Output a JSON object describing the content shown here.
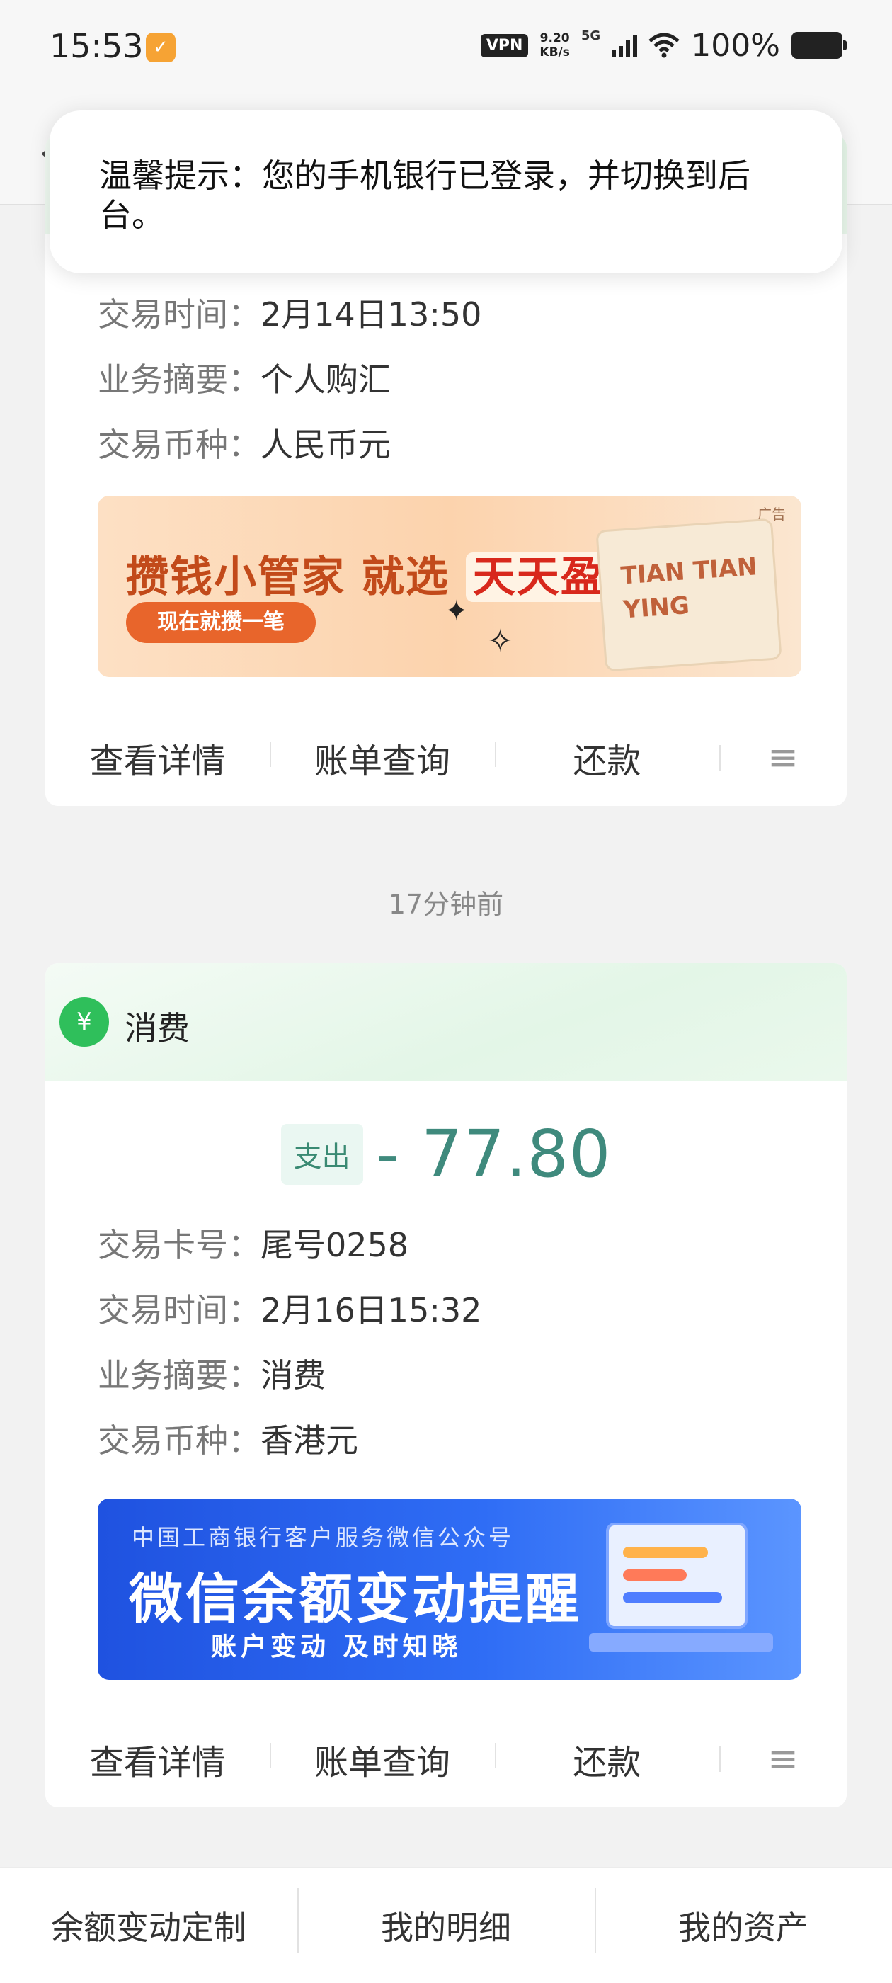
{
  "status_bar": {
    "time": "15:53",
    "app_badge": "✓",
    "vpn": "VPN",
    "speed_value": "9.20",
    "speed_unit": "KB/s",
    "network": "5G",
    "battery": "100%"
  },
  "toast": {
    "text": "温馨提示：您的手机银行已登录，并切换到后台。"
  },
  "card1": {
    "rows": [
      {
        "key": "交易时间：",
        "value": "2月14日13:50"
      },
      {
        "key": "业务摘要：",
        "value": "个人购汇"
      },
      {
        "key": "交易币种：",
        "value": "人民币元"
      }
    ],
    "banner": {
      "title_main": "攒钱小管家 就选",
      "title_highlight": "天天盈",
      "button": "现在就攒一笔",
      "ad_label": "广告",
      "board_text": "TIAN TIAN YING"
    },
    "actions": [
      "查看详情",
      "账单查询",
      "还款",
      "≡"
    ]
  },
  "timestamp": "17分钟前",
  "card2": {
    "title": "消费",
    "icon": "¥",
    "tag": "支出",
    "amount": "- 77.80",
    "rows": [
      {
        "key": "交易卡号：",
        "value": "尾号0258"
      },
      {
        "key": "交易时间：",
        "value": "2月16日15:32"
      },
      {
        "key": "业务摘要：",
        "value": "消费"
      },
      {
        "key": "交易币种：",
        "value": "香港元"
      }
    ],
    "banner": {
      "subtitle": "中国工商银行客户服务微信公众号",
      "title": "微信余额变动提醒",
      "tagline": "账户变动 及时知晓"
    },
    "actions": [
      "查看详情",
      "账单查询",
      "还款",
      "≡"
    ]
  },
  "bottom_tabs": [
    "余额变动定制",
    "我的明细",
    "我的资产"
  ],
  "colors": {
    "accent_green": "#2fbf5b",
    "amount": "#3f8a7d",
    "banner_blue": "#2f6df5",
    "banner_orange": "#e8652b"
  }
}
